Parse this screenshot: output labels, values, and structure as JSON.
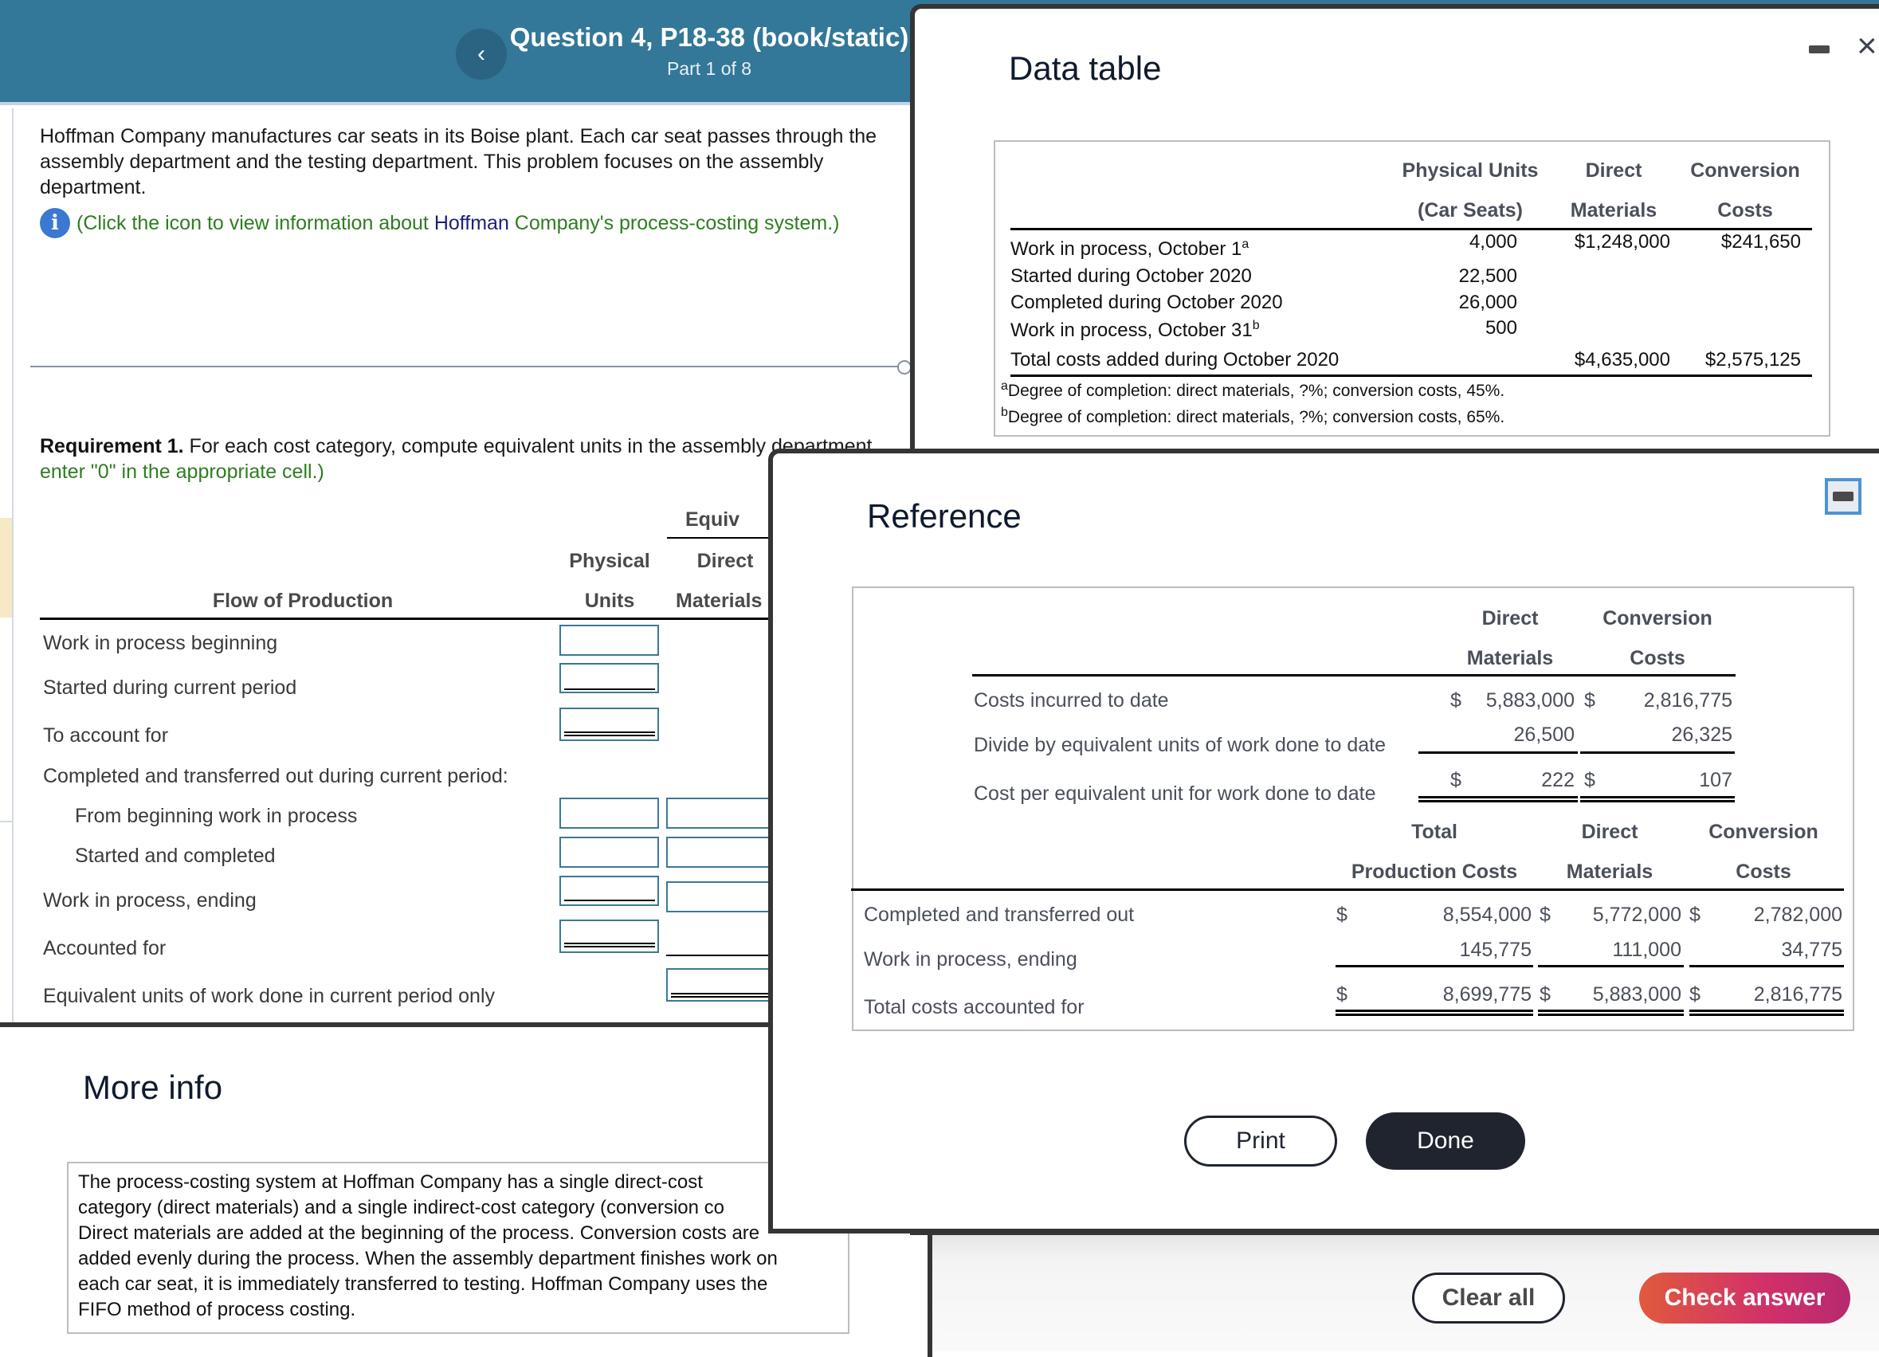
{
  "header": {
    "title": "Question 4, P18-38 (book/static)",
    "part": "Part 1 of 8",
    "back_icon": "‹"
  },
  "intro": {
    "text": "Hoffman Company manufactures car seats in its Boise plant. Each car seat passes through the assembly department and the testing department. This problem focuses on the assembly department.",
    "info_prefix": "(Click the icon to view information about ",
    "info_company": "Hoffman",
    "info_suffix": " Company's process-costing system.)",
    "info_icon": "i"
  },
  "requirement": {
    "label": "Requirement 1.",
    "text": " For each cost category, compute equivalent units in the assembly department",
    "note": "enter \"0\" in the appropriate cell.)"
  },
  "eu_table": {
    "group_header": "Equiv",
    "col_flow": "Flow of Production",
    "col_physical_1": "Physical",
    "col_physical_2": "Units",
    "col_dm_1": "Direct",
    "col_dm_2": "Materials",
    "rows": [
      "Work in process beginning",
      "Started during current period",
      "To account for",
      "Completed and transferred out during current period:",
      "From beginning work in process",
      "Started and completed",
      "Work in process, ending",
      "Accounted for",
      "Equivalent units of work done in current period only"
    ],
    "values": {
      "physical": [
        "",
        "",
        "",
        "",
        "",
        "",
        ""
      ],
      "direct_materials": [
        "",
        "",
        "",
        "",
        ""
      ]
    }
  },
  "more_info": {
    "title": "More info",
    "text": "The process-costing system at Hoffman Company has a single direct-cost category (direct materials) and a single indirect-cost category (conversion costs). Direct materials are added at the beginning of the process. Conversion costs are added evenly during the process. When the assembly department finishes work on each car seat, it is immediately transferred to testing. Hoffman Company uses the FIFO method of process costing.",
    "line1": "The process-costing system at Hoffman Company has a single direct-cost",
    "line2": "category (direct materials) and a single indirect-cost category (conversion co",
    "line3": "Direct materials are added at the beginning of the process. Conversion costs are",
    "line4": "added evenly during the process. When the assembly department finishes work on",
    "line5": "each car seat, it is immediately transferred to testing. Hoffman Company uses the",
    "line6": "FIFO method of process costing."
  },
  "actions": {
    "clear_all": "Clear all",
    "check_answer": "Check answer"
  },
  "data_table": {
    "title": "Data table",
    "minimize_icon": "minimize",
    "close_icon": "×",
    "headers": {
      "physical_1": "Physical Units",
      "physical_2": "(Car Seats)",
      "dm_1": "Direct",
      "dm_2": "Materials",
      "cc_1": "Conversion",
      "cc_2": "Costs"
    },
    "rows": [
      {
        "label": "Work in process, October 1",
        "sup": "a",
        "physical": "4,000",
        "dm": "$1,248,000",
        "cc": "$241,650"
      },
      {
        "label": "Started during October 2020",
        "sup": "",
        "physical": "22,500",
        "dm": "",
        "cc": ""
      },
      {
        "label": "Completed during October 2020",
        "sup": "",
        "physical": "26,000",
        "dm": "",
        "cc": ""
      },
      {
        "label": "Work in process, October 31",
        "sup": "b",
        "physical": "500",
        "dm": "",
        "cc": ""
      },
      {
        "label": "Total costs added during October 2020",
        "sup": "",
        "physical": "",
        "dm": "$4,635,000",
        "cc": "$2,575,125"
      }
    ],
    "footnotes": [
      {
        "mark": "a",
        "text": "Degree of completion: direct materials, ?%; conversion costs, 45%."
      },
      {
        "mark": "b",
        "text": "Degree of completion: direct materials, ?%; conversion costs, 65%."
      }
    ]
  },
  "reference": {
    "title": "Reference",
    "table1": {
      "headers": {
        "dm_1": "Direct",
        "dm_2": "Materials",
        "cc_1": "Conversion",
        "cc_2": "Costs"
      },
      "rows": [
        {
          "label": "Costs incurred to date",
          "dm_sym": "$",
          "dm": "5,883,000",
          "cc_sym": "$",
          "cc": "2,816,775"
        },
        {
          "label": "Divide by equivalent units of work done to date",
          "dm_sym": "",
          "dm": "26,500",
          "cc_sym": "",
          "cc": "26,325"
        },
        {
          "label": "Cost per equivalent unit for work done to date",
          "dm_sym": "$",
          "dm": "222",
          "cc_sym": "$",
          "cc": "107"
        }
      ]
    },
    "table2": {
      "headers": {
        "total_1": "Total",
        "total_2": "Production Costs",
        "dm_1": "Direct",
        "dm_2": "Materials",
        "cc_1": "Conversion",
        "cc_2": "Costs"
      },
      "rows": [
        {
          "label": "Completed and transferred out",
          "t_sym": "$",
          "total": "8,554,000",
          "dm_sym": "$",
          "dm": "5,772,000",
          "cc_sym": "$",
          "cc": "2,782,000"
        },
        {
          "label": "Work in process, ending",
          "t_sym": "",
          "total": "145,775",
          "dm_sym": "",
          "dm": "111,000",
          "cc_sym": "",
          "cc": "34,775"
        },
        {
          "label": "Total costs accounted for",
          "t_sym": "$",
          "total": "8,699,775",
          "dm_sym": "$",
          "dm": "5,883,000",
          "cc_sym": "$",
          "cc": "2,816,775"
        }
      ]
    },
    "print": "Print",
    "done": "Done"
  }
}
